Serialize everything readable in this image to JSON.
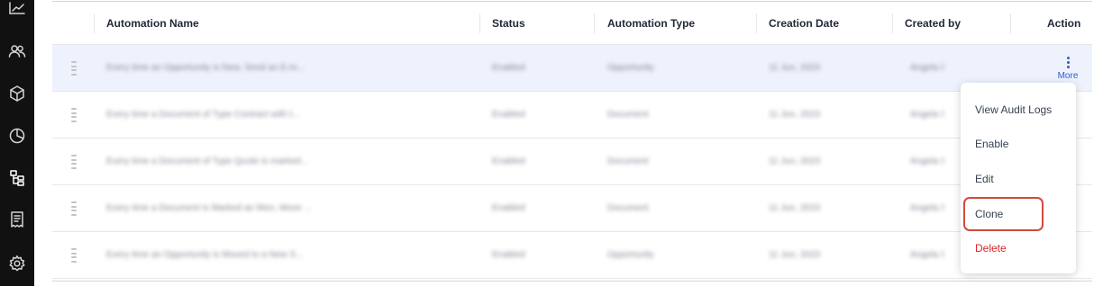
{
  "sidebar": {
    "icons": [
      "trending-up-icon",
      "users-icon",
      "box-icon",
      "pie-chart-icon",
      "hierarchy-icon",
      "receipt-icon",
      "settings-icon"
    ]
  },
  "table": {
    "columns": [
      "Automation Name",
      "Status",
      "Automation Type",
      "Creation Date",
      "Created by",
      "Action"
    ],
    "rows": [
      {
        "name": "Every time an Opportunity is New, Send an E-m...",
        "status": "Enabled",
        "type": "Opportunity",
        "date": "11 Jun, 2023",
        "created_by": "Angela Stilt",
        "selected": true
      },
      {
        "name": "Every time a Document of Type Contract with t...",
        "status": "Enabled",
        "type": "Document",
        "date": "11 Jun, 2023",
        "created_by": "Angela Stilt",
        "selected": false
      },
      {
        "name": "Every time a Document of Type Quote is marked...",
        "status": "Enabled",
        "type": "Document",
        "date": "11 Jun, 2023",
        "created_by": "Angela Stilt",
        "selected": false
      },
      {
        "name": "Every time a Document is Marked as Won, Move ...",
        "status": "Enabled",
        "type": "Document",
        "date": "11 Jun, 2023",
        "created_by": "Angela Stilt",
        "selected": false
      },
      {
        "name": "Every time an Opportunity is Moved to a New S...",
        "status": "Enabled",
        "type": "Opportunity",
        "date": "11 Jun, 2023",
        "created_by": "Angela Stilt",
        "selected": false
      }
    ],
    "more_label": "More"
  },
  "action_menu": {
    "items": [
      "View Audit Logs",
      "Enable",
      "Edit",
      "Clone",
      "Delete"
    ],
    "highlighted": "Clone",
    "highlight_color": "#d14a3c",
    "delete_color": "#dc2626"
  },
  "colors": {
    "sidebar": "#111111",
    "accent": "#2c5ccf",
    "selected_row": "#eef2fd"
  }
}
